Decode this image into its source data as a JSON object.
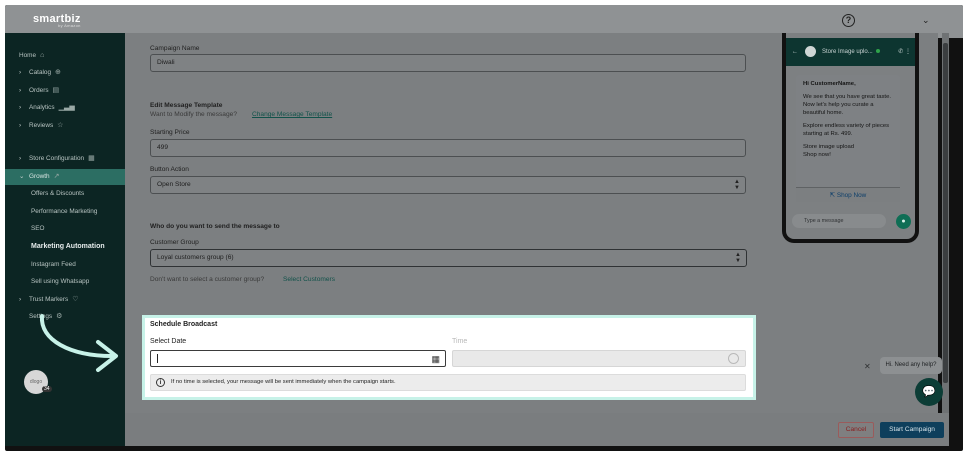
{
  "brand": {
    "name": "smartbiz",
    "tagline": "by Amazon"
  },
  "header": {
    "help_icon": "?",
    "menu_caret": "⌄"
  },
  "sidebar": {
    "items": [
      {
        "label": "Home",
        "icon": "⌂"
      },
      {
        "label": "Catalog",
        "icon": "⊕"
      },
      {
        "label": "Orders",
        "icon": "▤"
      },
      {
        "label": "Analytics",
        "icon": "▁▃▅"
      },
      {
        "label": "Reviews",
        "icon": "☆"
      },
      {
        "label": "Store Configuration",
        "icon": "▦"
      },
      {
        "label": "Growth",
        "icon": "↗"
      },
      {
        "label": "Offers & Discounts"
      },
      {
        "label": "Performance Marketing"
      },
      {
        "label": "SEO"
      },
      {
        "label": "Marketing Automation"
      },
      {
        "label": "Instagram Feed"
      },
      {
        "label": "Sell using Whatsapp"
      },
      {
        "label": "Trust Markers",
        "icon": "♡"
      },
      {
        "label": "Settings",
        "icon": "⚙"
      }
    ],
    "avatar_text": "dlogo",
    "avatar_badge": "34"
  },
  "form": {
    "campaign_name_label": "Campaign Name",
    "campaign_name_value": "Diwali",
    "edit_template_title": "Edit Message Template",
    "edit_template_question": "Want to Modify the message?",
    "edit_template_link": "Change Message Template",
    "starting_price_label": "Starting Price",
    "starting_price_value": "499",
    "button_action_label": "Button Action",
    "button_action_value": "Open Store",
    "audience_title": "Who do you want to send the message to",
    "customer_group_label": "Customer Group",
    "customer_group_value": "Loyal customers group (6)",
    "no_group_question": "Don't want to select a customer group?",
    "select_customers_link": "Select Customers"
  },
  "schedule": {
    "title": "Schedule Broadcast",
    "date_label": "Select Date",
    "time_label": "Time",
    "info_text": "If no time is selected, your message will be sent immediately when the campaign starts."
  },
  "preview": {
    "header_name": "Store Image uplo...",
    "greeting": "Hi CustomerName,",
    "line1": "We see that you have great taste. Now let's help you curate a beautiful home.",
    "line2": "Explore endless variety of pieces starting at Rs. 499.",
    "line3": "Store image upload",
    "line4": "Shop now!",
    "cta": "Shop Now",
    "input_placeholder": "Type a message"
  },
  "help_widget": {
    "text": "Hi. Need any help?"
  },
  "footer": {
    "cancel": "Cancel",
    "start": "Start Campaign"
  },
  "colors": {
    "highlight_border": "#c7f2e8",
    "sidebar_bg": "#0c2523",
    "accent": "#2c6e63",
    "primary_button": "#0e3f5c"
  }
}
